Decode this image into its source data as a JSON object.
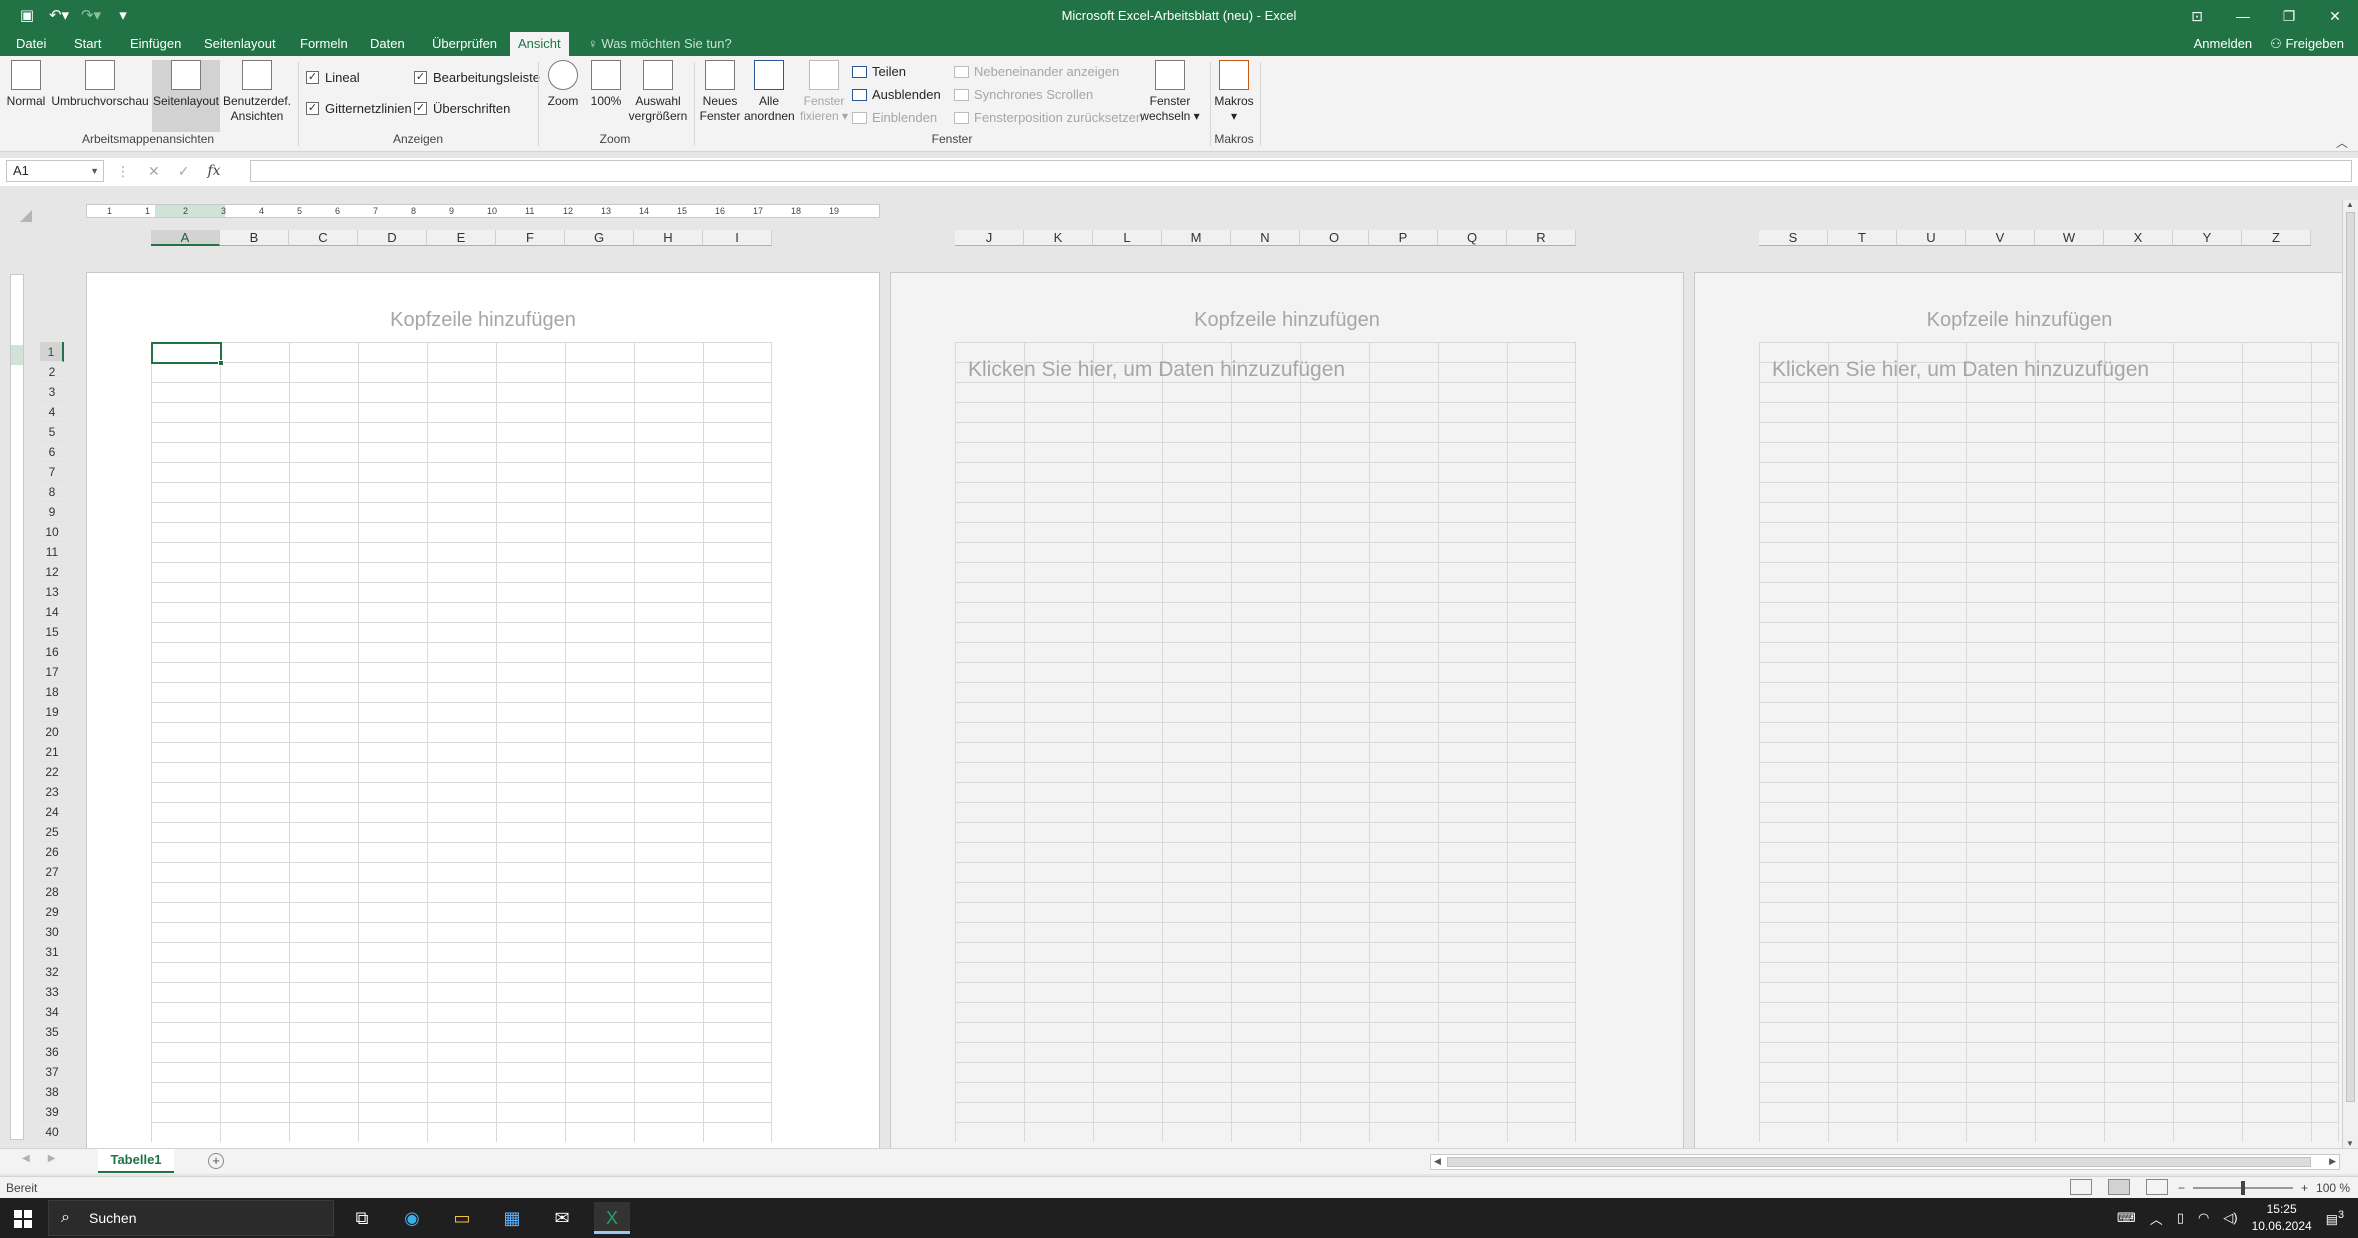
{
  "titlebar": {
    "title": "Microsoft Excel-Arbeitsblatt (neu) - Excel",
    "qat": [
      "save-icon",
      "undo-icon",
      "redo-icon",
      "customize-icon"
    ]
  },
  "tabs": [
    {
      "label": "Datei",
      "active": false
    },
    {
      "label": "Start",
      "active": false
    },
    {
      "label": "Einfügen",
      "active": false
    },
    {
      "label": "Seitenlayout",
      "active": false
    },
    {
      "label": "Formeln",
      "active": false
    },
    {
      "label": "Daten",
      "active": false
    },
    {
      "label": "Überprüfen",
      "active": false
    },
    {
      "label": "Ansicht",
      "active": true
    }
  ],
  "tellme": "Was möchten Sie tun?",
  "account": {
    "signin": "Anmelden",
    "share": "Freigeben"
  },
  "ribbon": {
    "workbook_views": {
      "label": "Arbeitsmappenansichten",
      "normal": "Normal",
      "pagebreak": "Umbruchvorschau",
      "pagelayout": "Seitenlayout",
      "custom_line1": "Benutzerdef.",
      "custom_line2": "Ansichten"
    },
    "show": {
      "label": "Anzeigen",
      "ruler": "Lineal",
      "formulabar": "Bearbeitungsleiste",
      "gridlines": "Gitternetzlinien",
      "headings": "Überschriften"
    },
    "zoom": {
      "label": "Zoom",
      "zoom": "Zoom",
      "hundred": "100%",
      "selection_line1": "Auswahl",
      "selection_line2": "vergrößern"
    },
    "window": {
      "label": "Fenster",
      "newwindow_line1": "Neues",
      "newwindow_line2": "Fenster",
      "arrange_line1": "Alle",
      "arrange_line2": "anordnen",
      "freeze_line1": "Fenster",
      "freeze_line2": "fixieren",
      "split": "Teilen",
      "hide": "Ausblenden",
      "unhide": "Einblenden",
      "sidebyside": "Nebeneinander anzeigen",
      "syncscroll": "Synchrones Scrollen",
      "resetpos": "Fensterposition zurücksetzen",
      "switch_line1": "Fenster",
      "switch_line2": "wechseln"
    },
    "macros": {
      "label": "Makros",
      "button": "Makros"
    }
  },
  "formulabar": {
    "namebox": "A1",
    "value": ""
  },
  "sheet": {
    "page1_columns": [
      "A",
      "B",
      "C",
      "D",
      "E",
      "F",
      "G",
      "H",
      "I"
    ],
    "page2_columns": [
      "J",
      "K",
      "L",
      "M",
      "N",
      "O",
      "P",
      "Q",
      "R"
    ],
    "page3_columns": [
      "S",
      "T",
      "U",
      "V",
      "W",
      "X",
      "Y",
      "Z"
    ],
    "rows": [
      "1",
      "2",
      "3",
      "4",
      "5",
      "6",
      "7",
      "8",
      "9",
      "10",
      "11",
      "12",
      "13",
      "14",
      "15",
      "16",
      "17",
      "18",
      "19",
      "20",
      "21",
      "22",
      "23",
      "24",
      "25",
      "26",
      "27",
      "28",
      "29",
      "30",
      "31",
      "32",
      "33",
      "34",
      "35",
      "36",
      "37",
      "38",
      "39",
      "40"
    ],
    "header_placeholder": "Kopfzeile hinzufügen",
    "click_placeholder": "Klicken Sie hier, um Daten hinzuzufügen",
    "ruler_numbers": [
      "1",
      "1",
      "2",
      "3",
      "4",
      "5",
      "6",
      "7",
      "8",
      "9",
      "10",
      "11",
      "12",
      "13",
      "14",
      "15",
      "16",
      "17",
      "18",
      "19"
    ]
  },
  "sheettabs": [
    {
      "label": "Tabelle1",
      "active": true
    }
  ],
  "status": {
    "ready": "Bereit",
    "zoom": "100 %"
  },
  "taskbar": {
    "search": "Suchen",
    "time": "15:25",
    "date": "10.06.2024",
    "notifications": "3"
  }
}
